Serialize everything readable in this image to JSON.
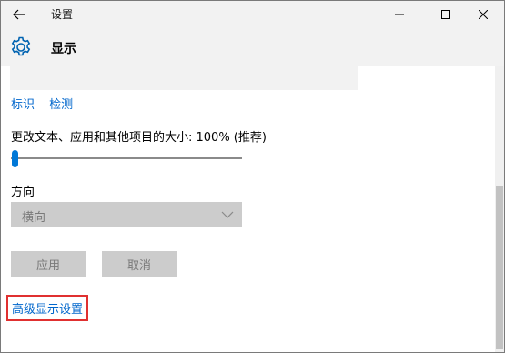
{
  "window": {
    "title": "设置"
  },
  "header": {
    "title": "显示",
    "icon": "gear-icon"
  },
  "links": {
    "identify": "标识",
    "detect": "检测"
  },
  "scale": {
    "label": "更改文本、应用和其他项目的大小: 100% (推荐)",
    "value_fraction": 0
  },
  "orientation": {
    "label": "方向",
    "selected": "横向"
  },
  "buttons": {
    "apply": "应用",
    "cancel": "取消"
  },
  "advanced_link": "高级显示设置",
  "colors": {
    "accent": "#0078d7",
    "link": "#0066cc",
    "highlight_border": "#e03030",
    "disabled_bg": "#cccccc"
  }
}
